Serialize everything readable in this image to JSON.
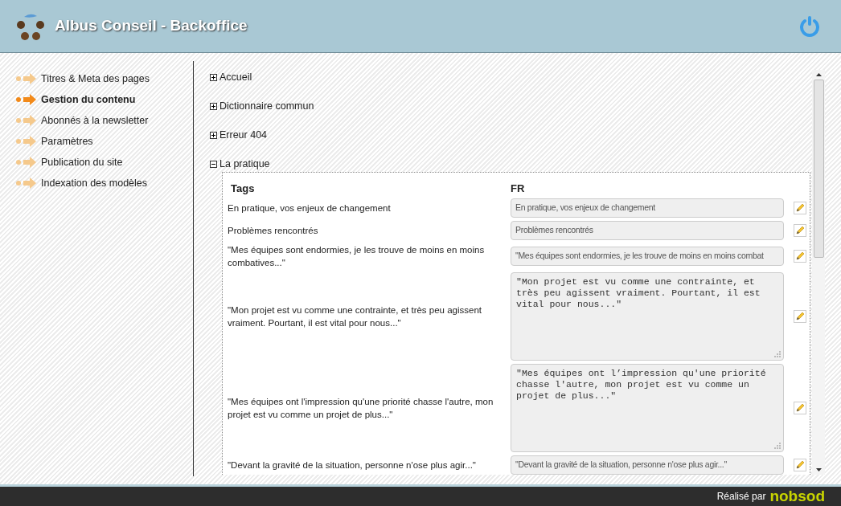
{
  "header": {
    "title": "Albus Conseil - Backoffice"
  },
  "sidebar": {
    "items": [
      {
        "label": "Titres & Meta des pages",
        "selected": false
      },
      {
        "label": "Gestion du contenu",
        "selected": true
      },
      {
        "label": "Abonnés à la newsletter",
        "selected": false
      },
      {
        "label": "Paramètres",
        "selected": false
      },
      {
        "label": "Publication du site",
        "selected": false
      },
      {
        "label": "Indexation des modèles",
        "selected": false
      }
    ]
  },
  "sections": [
    {
      "title": "Accueil",
      "expanded": false
    },
    {
      "title": "Dictionnaire commun",
      "expanded": false
    },
    {
      "title": "Erreur 404",
      "expanded": false
    },
    {
      "title": "La pratique",
      "expanded": true,
      "table": {
        "columns": [
          "Tags",
          "FR"
        ],
        "rows": [
          {
            "tag": "En pratique, vos enjeux de changement",
            "kind": "input",
            "value": "En pratique, vos enjeux de changement"
          },
          {
            "tag": "Problèmes rencontrés",
            "kind": "input",
            "value": "Problèmes rencontrés"
          },
          {
            "tag": "\"Mes équipes sont endormies, je les trouve de moins en moins combatives...\"",
            "kind": "input",
            "value": "\"Mes équipes sont endormies, je les trouve de moins en moins combat"
          },
          {
            "tag": "\"Mon projet est vu comme une contrainte, et très peu agissent vraiment. Pourtant, il est vital pour nous...\"",
            "kind": "textarea",
            "value": "\"Mon projet est vu comme une contrainte, et très peu agissent vraiment. Pourtant, il est vital pour nous...\""
          },
          {
            "tag": "\"Mes équipes ont l'impression qu'une priorité chasse l'autre, mon projet est vu comme un projet de plus...\"",
            "kind": "textarea",
            "value": "\"Mes équipes ont l’impression qu'une priorité chasse l'autre, mon projet est vu comme un projet de plus...\""
          },
          {
            "tag": "\"Devant la gravité de la situation, personne n'ose plus agir...\"",
            "kind": "input",
            "value": "\"Devant la gravité de la situation, personne n'ose plus agir...\""
          }
        ]
      }
    }
  ],
  "footer": {
    "credit": "Réalisé par",
    "logo": "nobsod"
  }
}
